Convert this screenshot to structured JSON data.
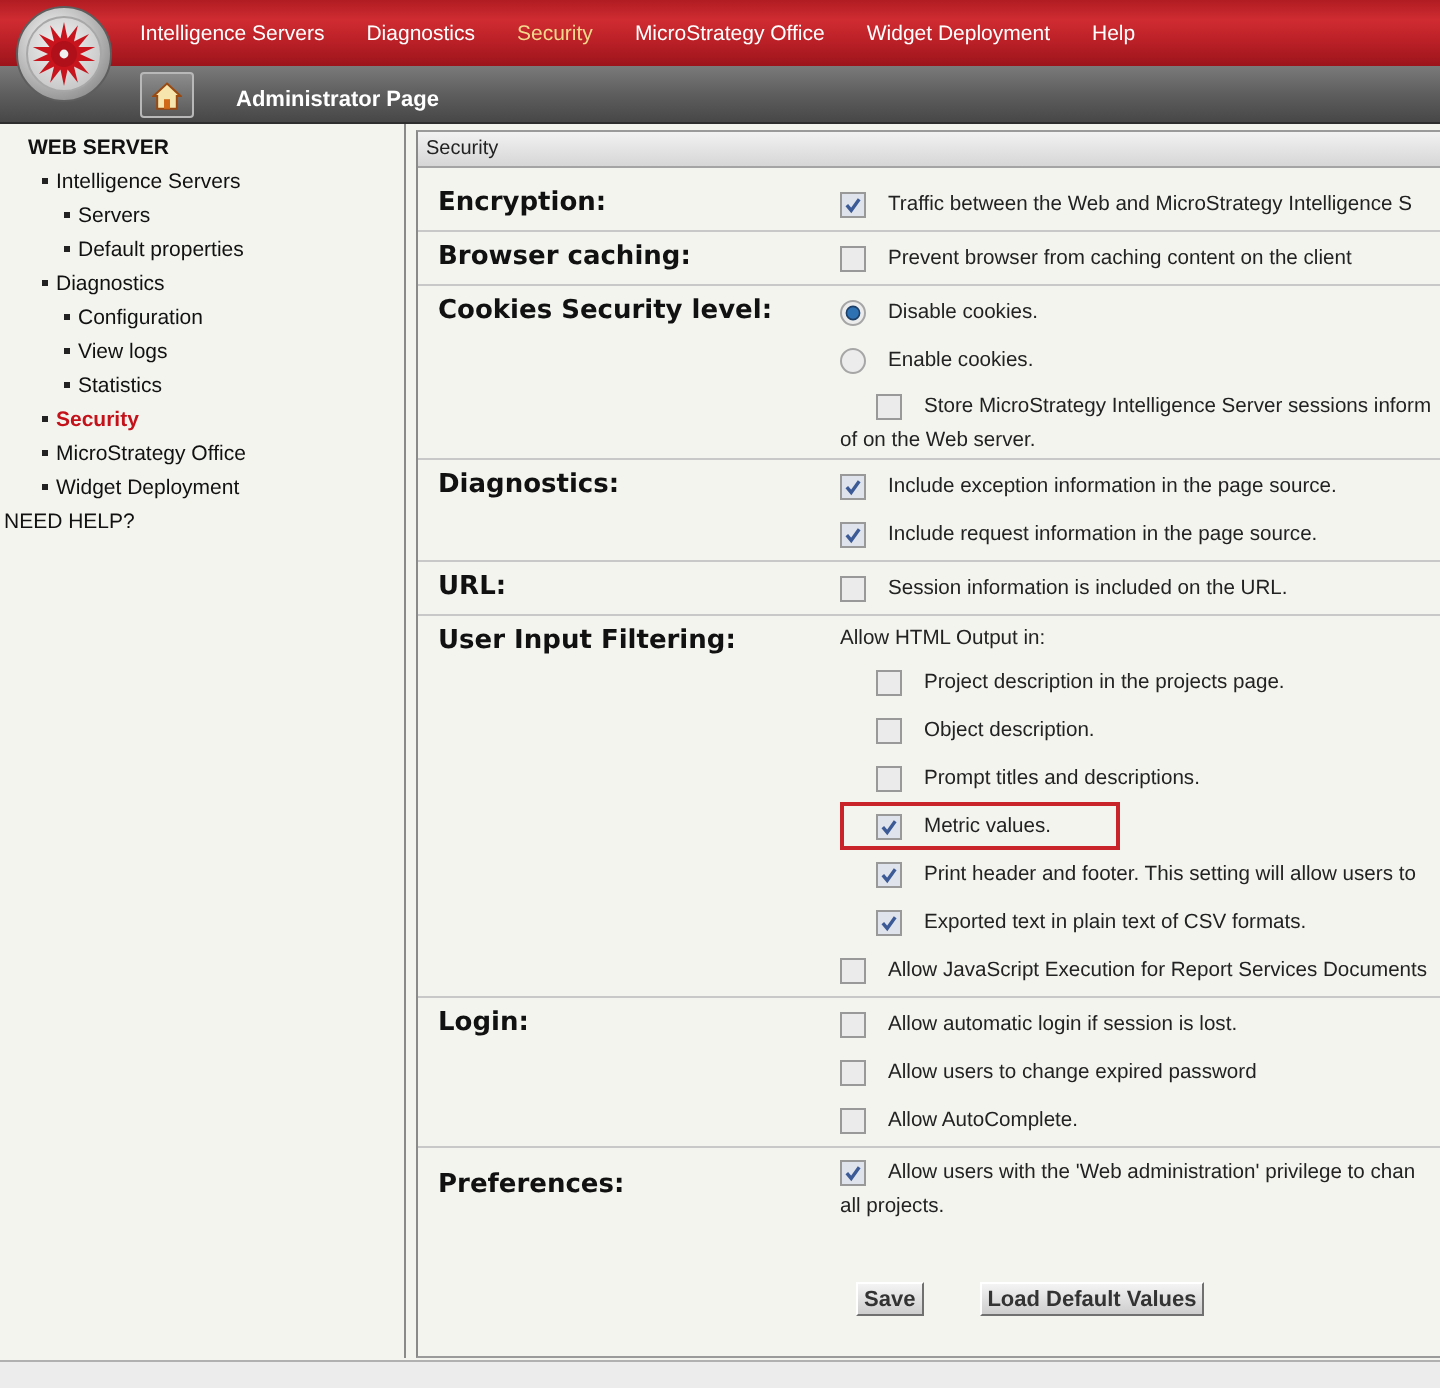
{
  "header": {
    "nav": [
      {
        "label": "Intelligence Servers",
        "selected": false
      },
      {
        "label": "Diagnostics",
        "selected": false
      },
      {
        "label": "Security",
        "selected": true
      },
      {
        "label": "MicroStrategy Office",
        "selected": false
      },
      {
        "label": "Widget Deployment",
        "selected": false
      },
      {
        "label": "Help",
        "selected": false
      }
    ],
    "title": "Administrator Page"
  },
  "sidebar": {
    "heading": "WEB SERVER",
    "items": [
      {
        "label": "Intelligence Servers",
        "selected": false,
        "children": [
          {
            "label": "Servers",
            "selected": false
          },
          {
            "label": "Default properties",
            "selected": false
          }
        ]
      },
      {
        "label": "Diagnostics",
        "selected": false,
        "children": [
          {
            "label": "Configuration",
            "selected": false
          },
          {
            "label": "View logs",
            "selected": false
          },
          {
            "label": "Statistics",
            "selected": false
          }
        ]
      },
      {
        "label": "Security",
        "selected": true
      },
      {
        "label": "MicroStrategy Office",
        "selected": false
      },
      {
        "label": "Widget Deployment",
        "selected": false
      }
    ],
    "help": "NEED HELP?"
  },
  "panel": {
    "title": "Security",
    "sections": [
      {
        "label": "Encryption:",
        "options": [
          {
            "kind": "checkbox",
            "text": "Traffic between the Web and MicroStrategy Intelligence S",
            "checked": true
          }
        ]
      },
      {
        "label": "Browser caching:",
        "options": [
          {
            "kind": "checkbox",
            "text": "Prevent browser from caching content on the client",
            "checked": false
          }
        ]
      },
      {
        "label": "Cookies Security level:",
        "options": [
          {
            "kind": "radio",
            "text": "Disable cookies.",
            "selected": true
          },
          {
            "kind": "radio",
            "text": "Enable cookies.",
            "selected": false,
            "children": [
              {
                "kind": "checkbox",
                "text": "Store MicroStrategy Intelligence Server sessions inform",
                "text_continued": "of on the Web server.",
                "checked": false
              }
            ]
          }
        ]
      },
      {
        "label": "Diagnostics:",
        "options": [
          {
            "kind": "checkbox",
            "text": "Include exception information in the page source.",
            "checked": true
          },
          {
            "kind": "checkbox",
            "text": "Include request information in the page source.",
            "checked": true
          }
        ]
      },
      {
        "label": "URL:",
        "options": [
          {
            "kind": "checkbox",
            "text": "Session information is included on the URL.",
            "checked": false
          }
        ]
      },
      {
        "label": "User Input Filtering:",
        "options": [
          {
            "kind": "note",
            "text": "Allow HTML Output in:",
            "children": [
              {
                "kind": "checkbox",
                "text": "Project description in the projects page.",
                "checked": false,
                "highlighted": false
              },
              {
                "kind": "checkbox",
                "text": "Object description.",
                "checked": false,
                "highlighted": false
              },
              {
                "kind": "checkbox",
                "text": "Prompt titles and descriptions.",
                "checked": false,
                "highlighted": false
              },
              {
                "kind": "checkbox",
                "text": "Metric values.",
                "checked": true,
                "highlighted": true
              },
              {
                "kind": "checkbox",
                "text": "Print header and footer. This setting will allow users to",
                "checked": true,
                "highlighted": false
              },
              {
                "kind": "checkbox",
                "text": "Exported text in plain text of CSV formats.",
                "checked": true,
                "highlighted": false
              }
            ]
          },
          {
            "kind": "checkbox",
            "text": "Allow JavaScript Execution for Report Services Documents",
            "checked": false
          }
        ]
      },
      {
        "label": "Login:",
        "options": [
          {
            "kind": "checkbox",
            "text": "Allow automatic login if session is lost.",
            "checked": false
          },
          {
            "kind": "checkbox",
            "text": "Allow users to change expired password",
            "checked": false
          },
          {
            "kind": "checkbox",
            "text": "Allow AutoComplete.",
            "checked": false
          }
        ]
      },
      {
        "label": "Preferences:",
        "options": [
          {
            "kind": "checkbox",
            "text": "Allow users with the 'Web administration' privilege to chan",
            "text_continued": "all projects.",
            "checked": true
          }
        ]
      }
    ],
    "buttons": [
      "Save",
      "Load Default Values"
    ]
  }
}
